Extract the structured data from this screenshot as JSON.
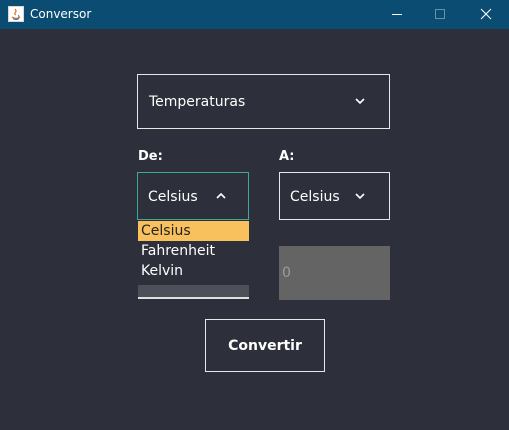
{
  "window": {
    "title": "Conversor"
  },
  "category_select": {
    "value": "Temperaturas"
  },
  "from": {
    "label": "De:",
    "value": "Celsius",
    "options": [
      "Celsius",
      "Fahrenheit",
      "Kelvin"
    ],
    "selected_option": "Celsius"
  },
  "to": {
    "label": "A:",
    "value": "Celsius"
  },
  "input": {
    "value": "0"
  },
  "convert_button": {
    "label": "Convertir"
  },
  "colors": {
    "title_bar": "#0b4d72",
    "background": "#2d2f3a",
    "selected_option": "#f9c15e",
    "focus_border": "#3ba99c",
    "input_bg": "#646464"
  }
}
